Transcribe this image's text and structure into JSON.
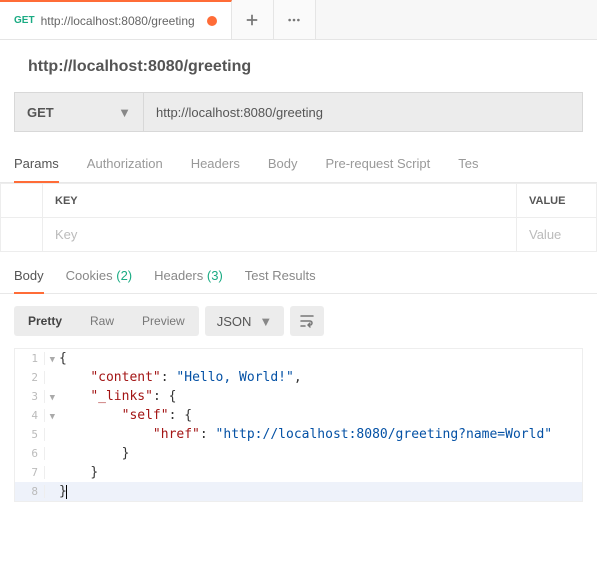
{
  "tab": {
    "method": "GET",
    "title": "http://localhost:8080/greeting"
  },
  "request": {
    "title": "http://localhost:8080/greeting",
    "method": "GET",
    "url": "http://localhost:8080/greeting"
  },
  "subtabs": {
    "params": "Params",
    "authorization": "Authorization",
    "headers": "Headers",
    "body": "Body",
    "prerequest": "Pre-request Script",
    "tests": "Tes"
  },
  "paramsTable": {
    "keyHeader": "KEY",
    "valueHeader": "VALUE",
    "keyPlaceholder": "Key",
    "valuePlaceholder": "Value"
  },
  "responseTabs": {
    "body": "Body",
    "cookies": "Cookies",
    "cookiesCount": "(2)",
    "headers": "Headers",
    "headersCount": "(3)",
    "testResults": "Test Results"
  },
  "bodyToolbar": {
    "pretty": "Pretty",
    "raw": "Raw",
    "preview": "Preview",
    "format": "JSON"
  },
  "code": {
    "l1": "{",
    "l2_k": "\"content\"",
    "l2_v": "\"Hello, World!\"",
    "l3_k": "\"_links\"",
    "l4_k": "\"self\"",
    "l5_k": "\"href\"",
    "l5_v": "\"http://localhost:8080/greeting?name=World\"",
    "l6": "}",
    "l7": "}",
    "l8": "}",
    "n1": "1",
    "n2": "2",
    "n3": "3",
    "n4": "4",
    "n5": "5",
    "n6": "6",
    "n7": "7",
    "n8": "8"
  }
}
